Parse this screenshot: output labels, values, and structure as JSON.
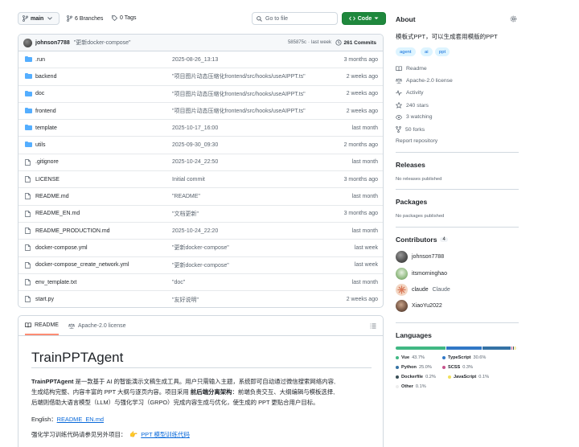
{
  "toolbar": {
    "branch": "main",
    "branches": "6 Branches",
    "tags": "0 Tags",
    "search_placeholder": "Go to file",
    "code_button": "Code"
  },
  "commit": {
    "author": "johnson7788",
    "message": "\"更新docker-compose\"",
    "sha": "585875c",
    "sep": "·",
    "time": "last week",
    "count": "261 Commits"
  },
  "files": [
    {
      "name": ".run",
      "type": "dir",
      "message": "2025-08-26_13:13",
      "time": "3 months ago"
    },
    {
      "name": "backend",
      "type": "dir",
      "message": "\"项目图片动态压缩化frontend/src/hooks/useAIPPT.ts\"",
      "time": "2 weeks ago"
    },
    {
      "name": "doc",
      "type": "dir",
      "message": "\"项目图片动态压缩化frontend/src/hooks/useAIPPT.ts\"",
      "time": "2 weeks ago"
    },
    {
      "name": "frontend",
      "type": "dir",
      "message": "\"项目图片动态压缩化frontend/src/hooks/useAIPPT.ts\"",
      "time": "2 weeks ago"
    },
    {
      "name": "template",
      "type": "dir",
      "message": "2025-10-17_16:00",
      "time": "last month"
    },
    {
      "name": "utils",
      "type": "dir",
      "message": "2025-09-30_09:30",
      "time": "2 months ago"
    },
    {
      "name": ".gitignore",
      "type": "file",
      "message": "2025-10-24_22:50",
      "time": "last month"
    },
    {
      "name": "LICENSE",
      "type": "file",
      "message": "Initial commit",
      "time": "3 months ago"
    },
    {
      "name": "README.md",
      "type": "file",
      "message": "\"README\"",
      "time": "last month"
    },
    {
      "name": "README_EN.md",
      "type": "file",
      "message": "\"文档更新\"",
      "time": "3 months ago"
    },
    {
      "name": "README_PRODUCTION.md",
      "type": "file",
      "message": "2025-10-24_22:20",
      "time": "last month"
    },
    {
      "name": "docker-compose.yml",
      "type": "file",
      "message": "\"更新docker-compose\"",
      "time": "last week"
    },
    {
      "name": "docker-compose_create_network.yml",
      "type": "file",
      "message": "\"更新docker-compose\"",
      "time": "last week"
    },
    {
      "name": "env_template.txt",
      "type": "file",
      "message": "\"doc\"",
      "time": "last month"
    },
    {
      "name": "start.py",
      "type": "file",
      "message": "\"友好说明\"",
      "time": "2 weeks ago"
    }
  ],
  "readme": {
    "tab_readme": "README",
    "tab_license": "Apache-2.0 license",
    "title": "TrainPPTAgent",
    "para_bold": "TrainPPTAgent",
    "para_1": " 是一款基于 AI 的智能演示文稿生成工具。用户只需输入主题，系统即可自动通过微信搜索网络内容,",
    "para_2": "生成结构完整、内容丰富的 PPT 大纲与逐页内容。项目采用 ",
    "para_2_bold": "前后端分离架构",
    "para_2_end": "：前端负责交互、大纲编辑与模板选择,",
    "para_3": "后端则借助大语言模型（LLM）与强化学习（GRPO）完成内容生成与优化，使生成的 PPT 更贴合用户目标。",
    "english_label": "English：",
    "english_link": "README_EN.md",
    "rl_label": "强化学习训练代码请参见另外项目：",
    "rl_link": "PPT 模型训练代码"
  },
  "about": {
    "heading": "About",
    "description": "模板式PPT，可以生成套用模版的PPT",
    "topics": [
      "agent",
      "ai",
      "ppt"
    ],
    "readme": "Readme",
    "license": "Apache-2.0 license",
    "activity": "Activity",
    "stars": "240 stars",
    "watching": "3 watching",
    "forks": "50 forks",
    "report": "Report repository"
  },
  "releases": {
    "heading": "Releases",
    "empty": "No releases published"
  },
  "packages": {
    "heading": "Packages",
    "empty": "No packages published"
  },
  "contributors": {
    "heading": "Contributors",
    "count": "4",
    "list": [
      {
        "name": "johnson7788",
        "sub": ""
      },
      {
        "name": "itsmorninghao",
        "sub": ""
      },
      {
        "name": "claude",
        "sub": "Claude"
      },
      {
        "name": "XiaoYu2022",
        "sub": ""
      }
    ]
  },
  "languages": {
    "heading": "Languages",
    "items": [
      {
        "name": "Vue",
        "pct": "43.7%",
        "value": 43.7,
        "color": "#41b883"
      },
      {
        "name": "TypeScript",
        "pct": "30.6%",
        "value": 30.6,
        "color": "#3178c6"
      },
      {
        "name": "Python",
        "pct": "25.0%",
        "value": 25.0,
        "color": "#3572A5"
      },
      {
        "name": "SCSS",
        "pct": "0.3%",
        "value": 0.3,
        "color": "#c6538c"
      },
      {
        "name": "Dockerfile",
        "pct": "0.2%",
        "value": 0.2,
        "color": "#384d54"
      },
      {
        "name": "JavaScript",
        "pct": "0.1%",
        "value": 0.1,
        "color": "#f1e05a"
      },
      {
        "name": "Other",
        "pct": "0.1%",
        "value": 0.1,
        "color": "#ededed"
      }
    ]
  }
}
